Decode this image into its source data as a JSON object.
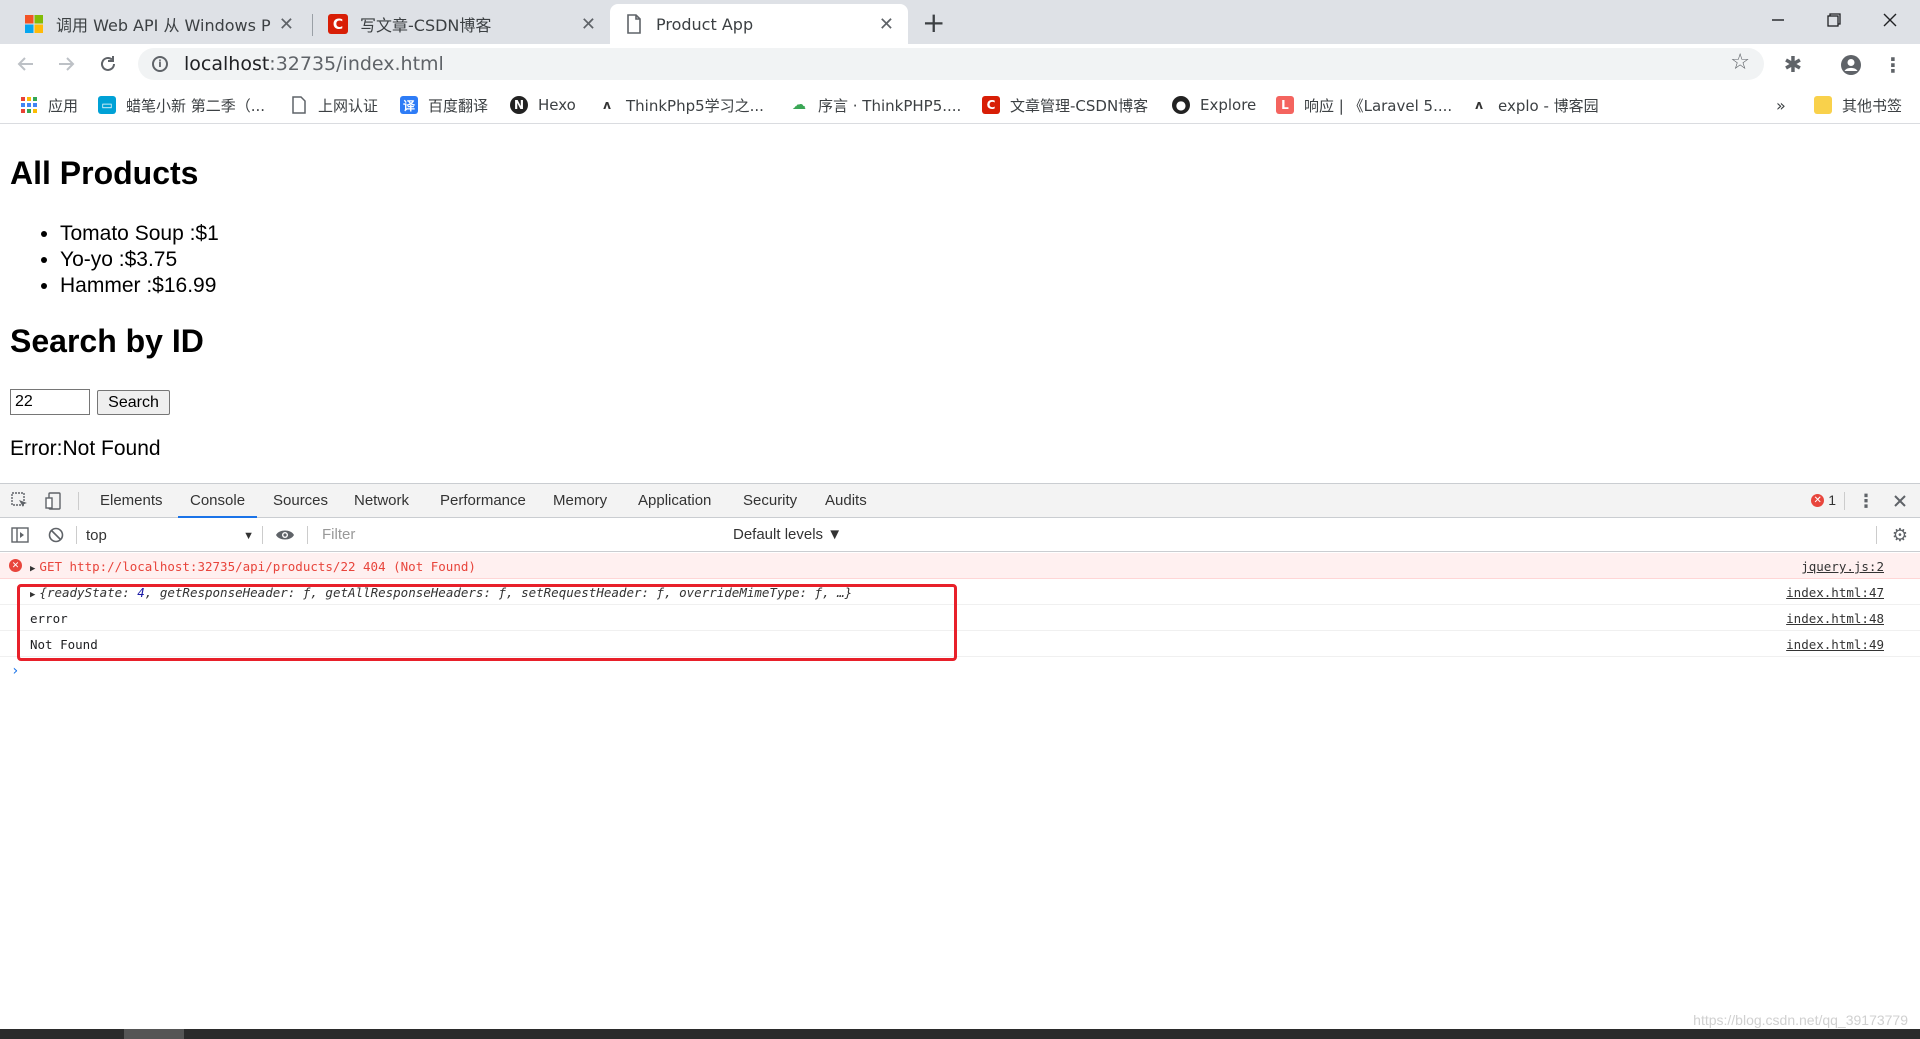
{
  "browser": {
    "tabs": [
      {
        "title": "调用 Web API 从 Windows Phone",
        "icon": "windows-logo-icon",
        "active": false
      },
      {
        "title": "写文章-CSDN博客",
        "icon": "csdn-c-icon",
        "active": false
      },
      {
        "title": "Product App",
        "icon": "page-icon",
        "active": true
      }
    ],
    "address": {
      "host": "localhost",
      "rest": ":32735/index.html"
    },
    "bookmarks": [
      {
        "label": "应用",
        "icon": "apps-grid-icon"
      },
      {
        "label": "蜡笔小新 第二季（...",
        "icon": "bilibili-tv-icon"
      },
      {
        "label": "上网认证",
        "icon": "page-icon"
      },
      {
        "label": "百度翻译",
        "icon": "translate-icon"
      },
      {
        "label": "Hexo",
        "icon": "hexo-icon"
      },
      {
        "label": "ThinkPhp5学习之...",
        "icon": "leaf-icon"
      },
      {
        "label": "序言 · ThinkPHP5....",
        "icon": "cloud-icon"
      },
      {
        "label": "文章管理-CSDN博客",
        "icon": "csdn-c-icon"
      },
      {
        "label": "Explore",
        "icon": "github-icon"
      },
      {
        "label": "响应 | 《Laravel 5....",
        "icon": "laravel-icon"
      },
      {
        "label": "explo - 博客园",
        "icon": "leaf-icon"
      }
    ],
    "more_bookmarks": "»",
    "other_bookmarks": "其他书签"
  },
  "page": {
    "heading_all": "All Products",
    "products": [
      "Tomato Soup :$1",
      "Yo-yo :$3.75",
      "Hammer :$16.99"
    ],
    "heading_search": "Search by ID",
    "search_value": "22",
    "search_button": "Search",
    "result": "Error:Not Found"
  },
  "devtools": {
    "tabs": [
      "Elements",
      "Console",
      "Sources",
      "Network",
      "Performance",
      "Memory",
      "Application",
      "Security",
      "Audits"
    ],
    "active_tab": "Console",
    "error_count": "1",
    "context": "top",
    "filter_placeholder": "Filter",
    "levels": "Default levels ▼",
    "messages": [
      {
        "type": "error",
        "text": "GET http://localhost:32735/api/products/22 404 (Not Found)",
        "source": "jquery.js:2"
      },
      {
        "type": "object",
        "text_pre": "{readyState: ",
        "num": "4",
        "text_post": ", getResponseHeader: ƒ, getAllResponseHeaders: ƒ, setRequestHeader: ƒ, overrideMimeType: ƒ, …}",
        "source": "index.html:47"
      },
      {
        "type": "log",
        "text": "error",
        "source": "index.html:48"
      },
      {
        "type": "log",
        "text": "Not Found",
        "source": "index.html:49"
      }
    ]
  },
  "watermark": "https://blog.csdn.net/qq_39173779"
}
